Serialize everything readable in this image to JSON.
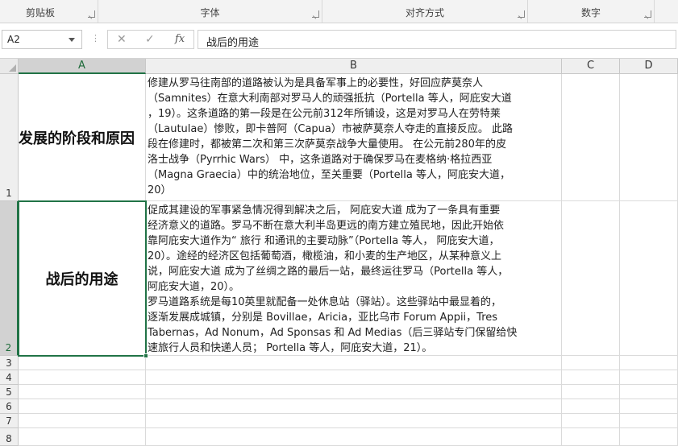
{
  "ribbon": {
    "groups": [
      "剪贴板",
      "字体",
      "对齐方式",
      "数字"
    ]
  },
  "formula_bar": {
    "name_box": "A2",
    "fx_label": "fx",
    "cancel_symbol": "✕",
    "enter_symbol": "✓",
    "separator": "⋮",
    "content": "战后的用途"
  },
  "columns": [
    "A",
    "B",
    "C",
    "D"
  ],
  "rows": [
    "1",
    "2",
    "3",
    "4",
    "5",
    "6",
    "7",
    "8"
  ],
  "cells": {
    "A1": "发展的阶段和原因",
    "A2": "战后的用途",
    "B1_lines": [
      "修建从罗马往南部的道路被认为是具备军事上的必要性，好回应萨莫奈人",
      "（Samnites）在意大利南部对罗马人的顽强抵抗（Portella 等人，阿庇安大道",
      "，19）。这条道路的第一段是在公元前312年所铺设，这是对罗马人在劳特莱",
      "（Lautulae）惨败，即卡普阿（Capua）市被萨莫奈人夺走的直接反应。 此路",
      "段在修建时，都被第二次和第三次萨莫奈战争大量使用。 在公元前280年的皮",
      "洛士战争（Pyrrhic Wars） 中，这条道路对于确保罗马在麦格纳·格拉西亚",
      "（Magna Graecia）中的统治地位，至关重要（Portella 等人，阿庇安大道，",
      "20）"
    ],
    "B2_lines": [
      "促成其建设的军事紧急情况得到解决之后， 阿庇安大道 成为了一条具有重要",
      "经济意义的道路。罗马不断在意大利半岛更远的南方建立殖民地，因此开始依",
      "靠阿庇安大道作为“ 旅行 和通讯的主要动脉”（Portella 等人， 阿庇安大道，",
      "20）。途经的经济区包括葡萄酒，橄榄油，和小麦的生产地区，从某种意义上",
      "说，阿庇安大道 成为了丝绸之路的最后一站，最终运往罗马（Portella 等人，",
      "阿庇安大道，20）。",
      "罗马道路系统是每10英里就配备一处休息站（驿站）。这些驿站中最显着的，",
      "逐渐发展成城镇，分别是 Bovillae，Aricia，亚比乌市 Forum Appii，Tres",
      "Tabernas，Ad Nonum，Ad Sponsas 和 Ad Medias（后三驿站专门保留给快",
      "速旅行人员和快递人员； Portella 等人，阿庇安大道，21）。"
    ]
  }
}
